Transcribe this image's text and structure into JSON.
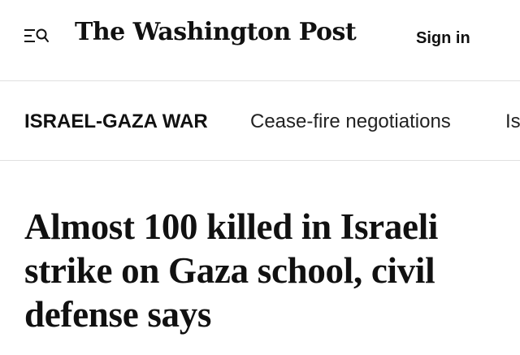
{
  "header": {
    "menu_icon": "menu-search-icon",
    "logo_text": "The Washington Post",
    "sign_in_label": "Sign in"
  },
  "nav": {
    "topic_label": "ISRAEL-GAZA WAR",
    "links": [
      "Cease-fire negotiations",
      "Is"
    ]
  },
  "article": {
    "headline": "Almost 100 killed in Israeli strike on Gaza school, civil defense says"
  },
  "colors": {
    "text": "#111111",
    "divider": "#e0e0e0",
    "background": "#ffffff"
  }
}
